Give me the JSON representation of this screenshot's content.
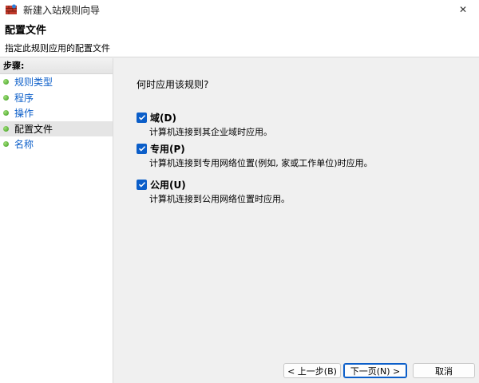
{
  "window": {
    "title": "新建入站规则向导",
    "close_glyph": "✕"
  },
  "header": {
    "title": "配置文件",
    "subtitle": "指定此规则应用的配置文件"
  },
  "sidebar": {
    "heading": "步骤:",
    "items": [
      {
        "label": "规则类型",
        "active": false
      },
      {
        "label": "程序",
        "active": false
      },
      {
        "label": "操作",
        "active": false
      },
      {
        "label": "配置文件",
        "active": true
      },
      {
        "label": "名称",
        "active": false
      }
    ]
  },
  "main": {
    "question": "何时应用该规则?",
    "options": [
      {
        "label": "域(D)",
        "description": "计算机连接到其企业域时应用。",
        "checked": true
      },
      {
        "label": "专用(P)",
        "description": "计算机连接到专用网络位置(例如, 家或工作单位)时应用。",
        "checked": true
      },
      {
        "label": "公用(U)",
        "description": "计算机连接到公用网络位置时应用。",
        "checked": true
      }
    ]
  },
  "buttons": {
    "back": "< 上一步(B)",
    "next": "下一页(N) >",
    "cancel": "取消"
  },
  "colors": {
    "accent": "#0b5ec9",
    "step_dot": "#3e9b1e"
  }
}
